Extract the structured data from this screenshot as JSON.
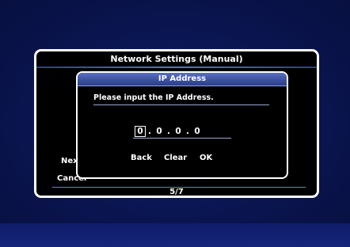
{
  "outer_dialog": {
    "title": "Network Settings (Manual)",
    "next_label": "Next",
    "cancel_label": "Cancel",
    "page_indicator": "5/7"
  },
  "inner_dialog": {
    "title": "IP Address",
    "prompt": "Please input the IP Address.",
    "ip": {
      "octets": [
        "0",
        "0",
        "0",
        "0"
      ],
      "separators": [
        ".",
        ".",
        "."
      ]
    },
    "buttons": {
      "back": "Back",
      "clear": "Clear",
      "ok": "OK"
    }
  },
  "colors": {
    "background": "#0a1550",
    "dialog": "#000000",
    "title_bar": "#3a4f9e",
    "border": "#ffffff"
  }
}
